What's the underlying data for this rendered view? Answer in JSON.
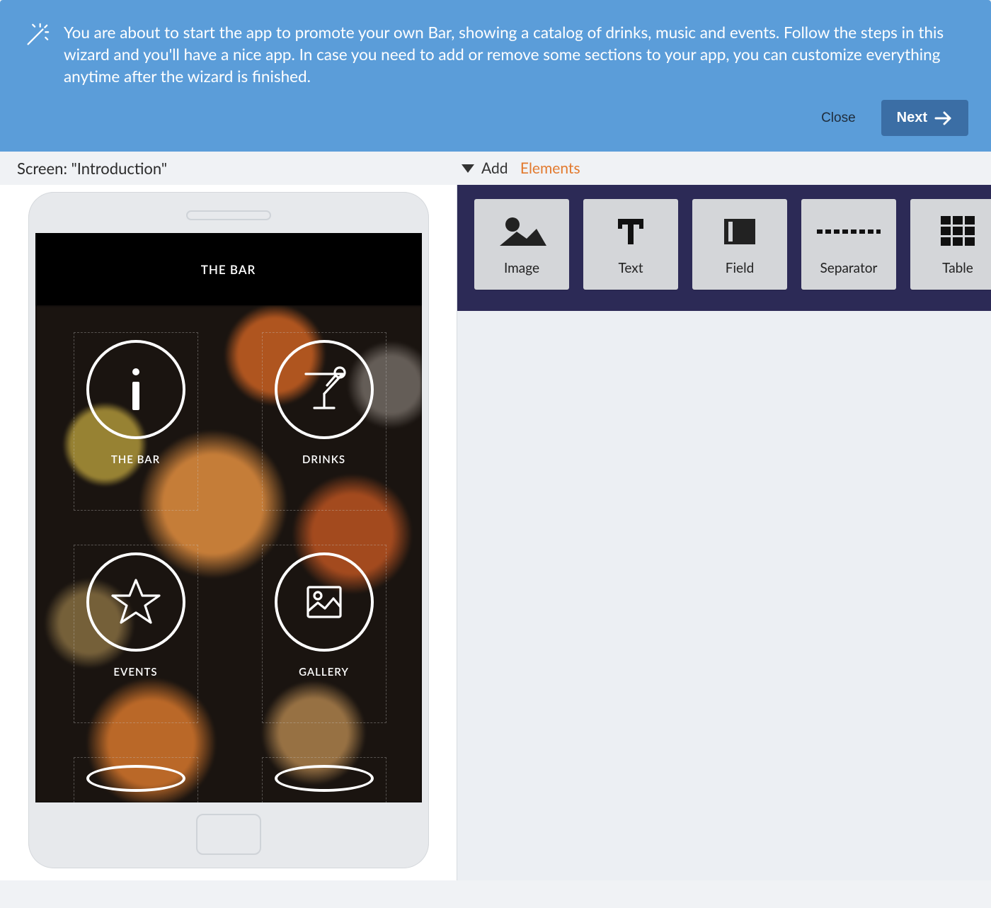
{
  "wizard": {
    "message": "You are about to start the app to promote your own Bar, showing  a catalog of drinks, music and events. Follow the steps in this wizard and you'll have a nice app. In case you need to add or remove some sections to your app, you can customize everything anytime after the wizard is finished.",
    "close_label": "Close",
    "next_label": "Next"
  },
  "subheader": {
    "screen_label": "Screen: \"Introduction\"",
    "add_label": "Add",
    "elements_label": "Elements"
  },
  "phone": {
    "app_title": "THE BAR",
    "menu": [
      {
        "label": "THE BAR",
        "icon": "info"
      },
      {
        "label": "DRINKS",
        "icon": "cocktail"
      },
      {
        "label": "EVENTS",
        "icon": "star"
      },
      {
        "label": "GALLERY",
        "icon": "gallery"
      },
      {
        "label": "",
        "icon": "circle"
      },
      {
        "label": "",
        "icon": "circle"
      }
    ]
  },
  "elements": [
    {
      "label": "Image",
      "icon": "image"
    },
    {
      "label": "Text",
      "icon": "text"
    },
    {
      "label": "Field",
      "icon": "field"
    },
    {
      "label": "Separator",
      "icon": "separator"
    },
    {
      "label": "Table",
      "icon": "table"
    }
  ]
}
